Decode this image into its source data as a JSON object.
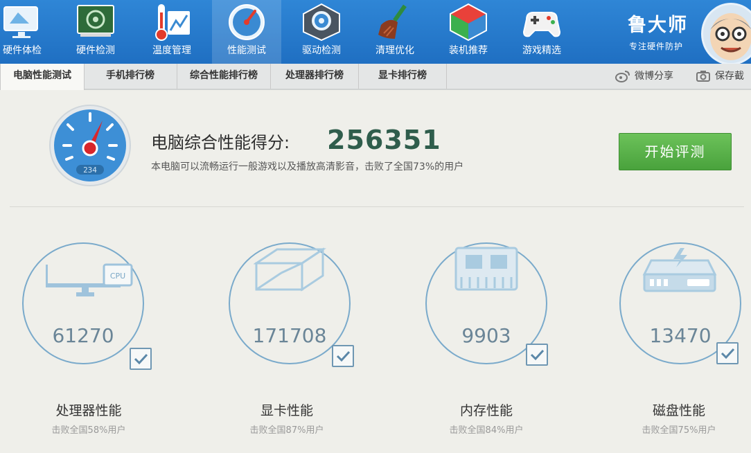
{
  "nav": {
    "items": [
      {
        "label": "硬件体检",
        "icon": "monitor-check-icon"
      },
      {
        "label": "硬件检测",
        "icon": "hardware-board-icon"
      },
      {
        "label": "温度管理",
        "icon": "thermometer-icon"
      },
      {
        "label": "性能测试",
        "icon": "speedometer-icon",
        "active": true
      },
      {
        "label": "驱动检测",
        "icon": "gear-cube-icon"
      },
      {
        "label": "清理优化",
        "icon": "broom-icon"
      },
      {
        "label": "装机推荐",
        "icon": "cube-icon"
      },
      {
        "label": "游戏精选",
        "icon": "gamepad-icon"
      }
    ]
  },
  "brand": {
    "name": "鲁大师",
    "tagline": "专注硬件防护",
    "avatar_icon": "master-lu-avatar-icon"
  },
  "tabs": [
    {
      "label": "电脑性能测试",
      "active": true
    },
    {
      "label": "手机排行榜"
    },
    {
      "label": "综合性能排行榜"
    },
    {
      "label": "处理器排行榜"
    },
    {
      "label": "显卡排行榜"
    }
  ],
  "share": {
    "weibo_label": "微博分享",
    "screenshot_label": "保存截"
  },
  "score": {
    "title": "电脑综合性能得分:",
    "value": "256351",
    "description": "本电脑可以流畅运行一般游戏以及播放高清影音，击败了全国73%的用户",
    "gauge_readout": "234",
    "start_button": "开始评测"
  },
  "components": [
    {
      "name": "处理器性能",
      "score": "61270",
      "beat": "击败全国58%用户",
      "icon": "cpu-monitor-icon",
      "icon_text": "CPU"
    },
    {
      "name": "显卡性能",
      "score": "171708",
      "beat": "击败全国87%用户",
      "icon": "graphics-cube-icon"
    },
    {
      "name": "内存性能",
      "score": "9903",
      "beat": "击败全国84%用户",
      "icon": "memory-chip-icon"
    },
    {
      "name": "磁盘性能",
      "score": "13470",
      "beat": "击败全国75%用户",
      "icon": "disk-drive-icon"
    }
  ],
  "colors": {
    "toolbar": "#2478cc",
    "accent_green": "#55ad46",
    "score_text": "#2f5d4c",
    "ring": "#7aaacb"
  }
}
